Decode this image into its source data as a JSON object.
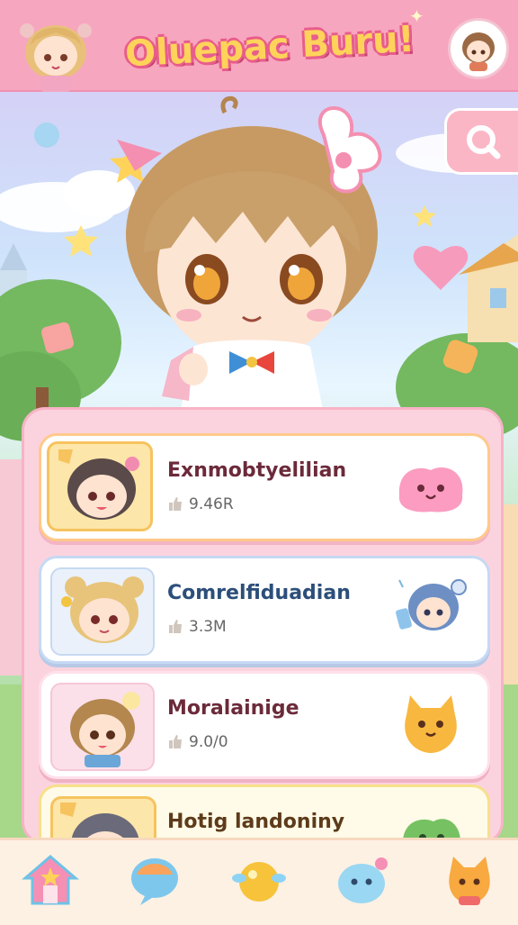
{
  "header": {
    "title": "Oluepac Buru!",
    "left_avatar": "chibi-girl-avatar-icon",
    "right_avatar": "profile-avatar-icon"
  },
  "search": {
    "icon": "search-icon"
  },
  "hero": {
    "icon": "chibi-character-illustration"
  },
  "list": {
    "items": [
      {
        "title": "Exnmobtyelilian",
        "count": "9.46R",
        "thumb": "chibi-dark-hair-avatar",
        "mascot": "pink-blob-mascot-icon",
        "accent": "#f6c35f"
      },
      {
        "title": "Comrelfiduadian",
        "count": "3.3M",
        "thumb": "chibi-blonde-avatar",
        "mascot": "blue-hair-character-icon",
        "accent": "#c7d9f1"
      },
      {
        "title": "Moralainige",
        "count": "9.0/0",
        "thumb": "chibi-brown-hair-avatar",
        "mascot": "orange-cat-mascot-icon",
        "accent": "#f6c7d6"
      },
      {
        "title": "Hotig landoniny",
        "count": "",
        "thumb": "chibi-purple-hair-avatar",
        "mascot": "green-blob-mascot-icon",
        "accent": "#f6c35f"
      }
    ]
  },
  "nav": {
    "items": [
      {
        "name": "home-icon"
      },
      {
        "name": "chat-icon"
      },
      {
        "name": "orb-icon"
      },
      {
        "name": "blob-icon"
      },
      {
        "name": "cat-icon"
      }
    ]
  },
  "colors": {
    "header": "#f7a6bf",
    "panel": "#fbd3de",
    "nav": "#fdf1e4",
    "title_fill": "#ffd35a",
    "title_outline": "#e85d8c"
  }
}
